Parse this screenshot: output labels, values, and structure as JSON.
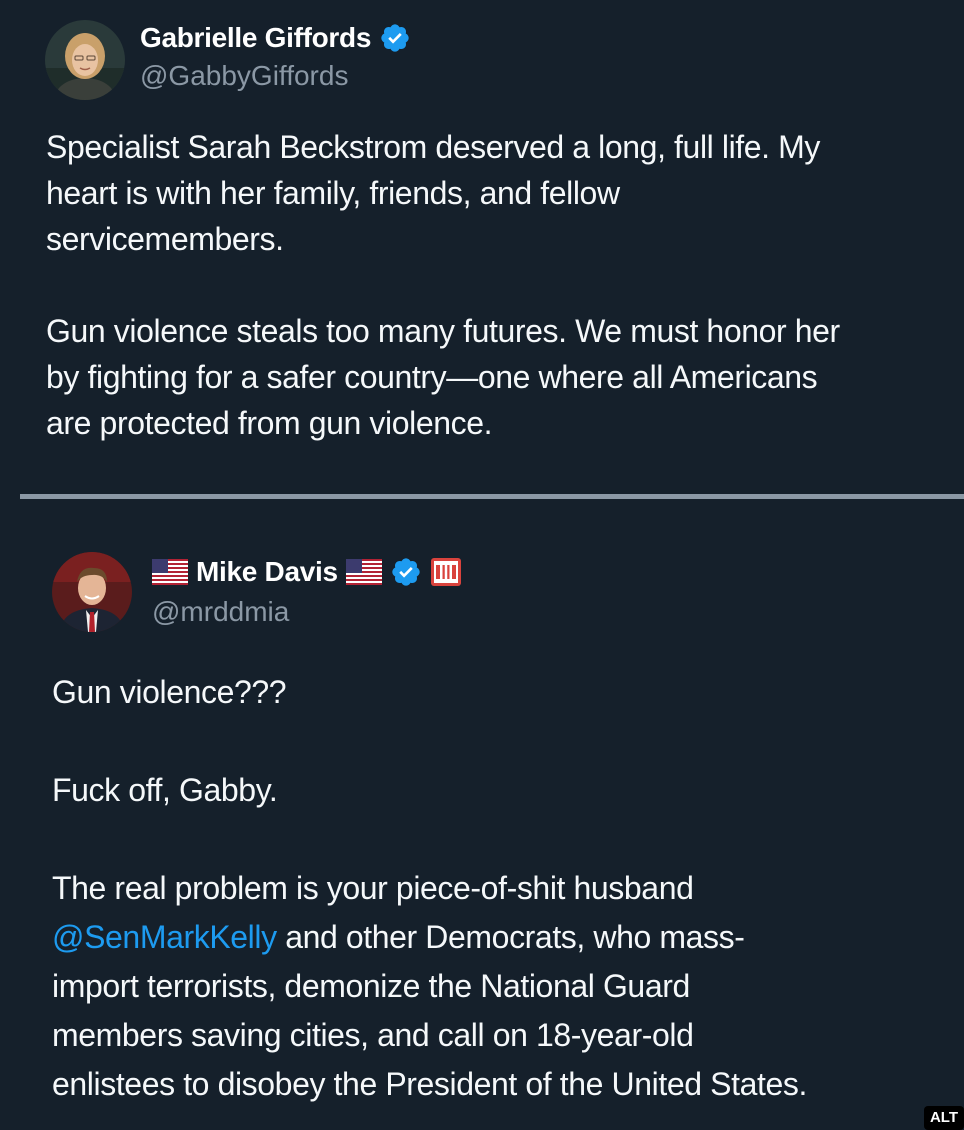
{
  "tweets": [
    {
      "display_name": "Gabrielle Giffords",
      "handle": "@GabbyGiffords",
      "verified_icon": "verified-badge-icon",
      "avatar": "profile-photo",
      "paragraphs": [
        {
          "lines": [
            "Specialist Sarah Beckstrom deserved a long, full life. My",
            "heart is with her family, friends, and fellow",
            "servicemembers."
          ]
        },
        {
          "lines": [
            "Gun violence steals too many futures. We must honor her",
            "by fighting for a safer country—one where all Americans",
            "are protected from gun violence."
          ]
        }
      ]
    },
    {
      "display_name": "Mike Davis",
      "handle": "@mrddmia",
      "flag_icon": "us-flag-icon",
      "verified_icon": "verified-badge-icon",
      "roman_numeral_icon": "roman-three-icon",
      "avatar": "profile-photo",
      "paragraphs": [
        {
          "lines": [
            "Gun violence???"
          ]
        },
        {
          "lines": [
            "Fuck off, Gabby."
          ]
        },
        {
          "line1": "The real problem is your piece-of-shit husband",
          "mention": "@SenMarkKelly",
          "line2_rest": " and other Democrats, who mass-",
          "line3": "import terrorists, demonize the National Guard",
          "line4": "members saving cities, and call on 18-year-old",
          "line5": "enlistees to disobey the President of the United States."
        }
      ]
    }
  ],
  "alt_badge": "ALT",
  "colors": {
    "background": "#15202b",
    "text": "#f5f8fa",
    "secondary_text": "#8b98a5",
    "link": "#1d9bf0",
    "verified": "#1d9bf0"
  }
}
